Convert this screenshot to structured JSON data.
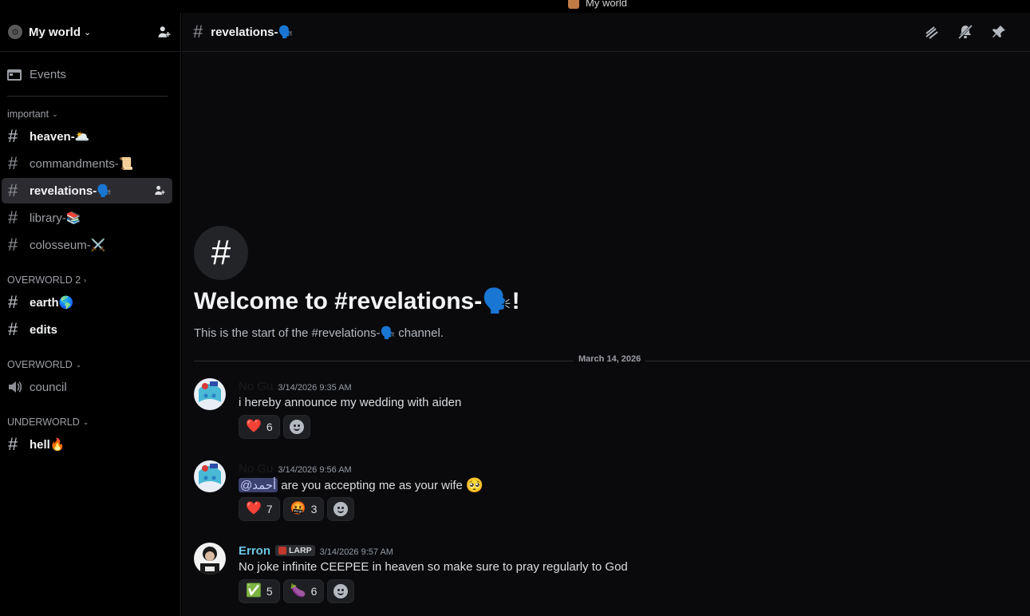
{
  "window": {
    "title": "My world"
  },
  "server": {
    "name": "My world",
    "chevron": "⌄"
  },
  "sidebar": {
    "events_label": "Events",
    "categories": [
      {
        "label": "important",
        "chevron": "⌄"
      },
      {
        "label": "OVERWORLD 2",
        "chevron": "›"
      },
      {
        "label": "OVERWORLD",
        "chevron": "⌄"
      },
      {
        "label": "UNDERWORLD",
        "chevron": "⌄"
      }
    ],
    "channels": [
      {
        "label": "heaven-🌥️"
      },
      {
        "label": "commandments-📜"
      },
      {
        "label": "revelations-🗣️"
      },
      {
        "label": "library-📚"
      },
      {
        "label": "colosseum-⚔️"
      },
      {
        "label": "earth🌎"
      },
      {
        "label": "edits"
      },
      {
        "label": "council"
      },
      {
        "label": "hell🔥"
      }
    ]
  },
  "channel_header": {
    "name": "revelations-🗣️"
  },
  "welcome": {
    "title": "Welcome to #revelations-🗣️!",
    "subtitle": "This is the start of the #revelations-🗣️ channel."
  },
  "date_divider": "March 14, 2026",
  "messages": [
    {
      "author": "No Gu",
      "time": "3/14/2026 9:35 AM",
      "text": "i hereby announce my wedding with aiden",
      "reactions": [
        {
          "emoji": "❤️",
          "count": "6"
        }
      ]
    },
    {
      "author": "No Gu",
      "time": "3/14/2026 9:56 AM",
      "mention": "@أحمد",
      "text": "are you accepting me as your wife",
      "trailing_emoji": "🥺",
      "reactions": [
        {
          "emoji": "❤️",
          "count": "7"
        },
        {
          "emoji": "🤬",
          "count": "3"
        }
      ]
    },
    {
      "author": "Erron",
      "tag": "LARP",
      "time": "3/14/2026 9:57 AM",
      "text": "No joke infinite CEEPEE in heaven so make sure to pray regularly to God",
      "reactions": [
        {
          "emoji": "✅",
          "count": "5"
        },
        {
          "emoji": "🍆",
          "count": "6"
        }
      ]
    }
  ],
  "colors": {
    "accent_cyan": "#6bc7e4",
    "mention_bg": "#3c4270",
    "background": "#0a0a0c"
  }
}
